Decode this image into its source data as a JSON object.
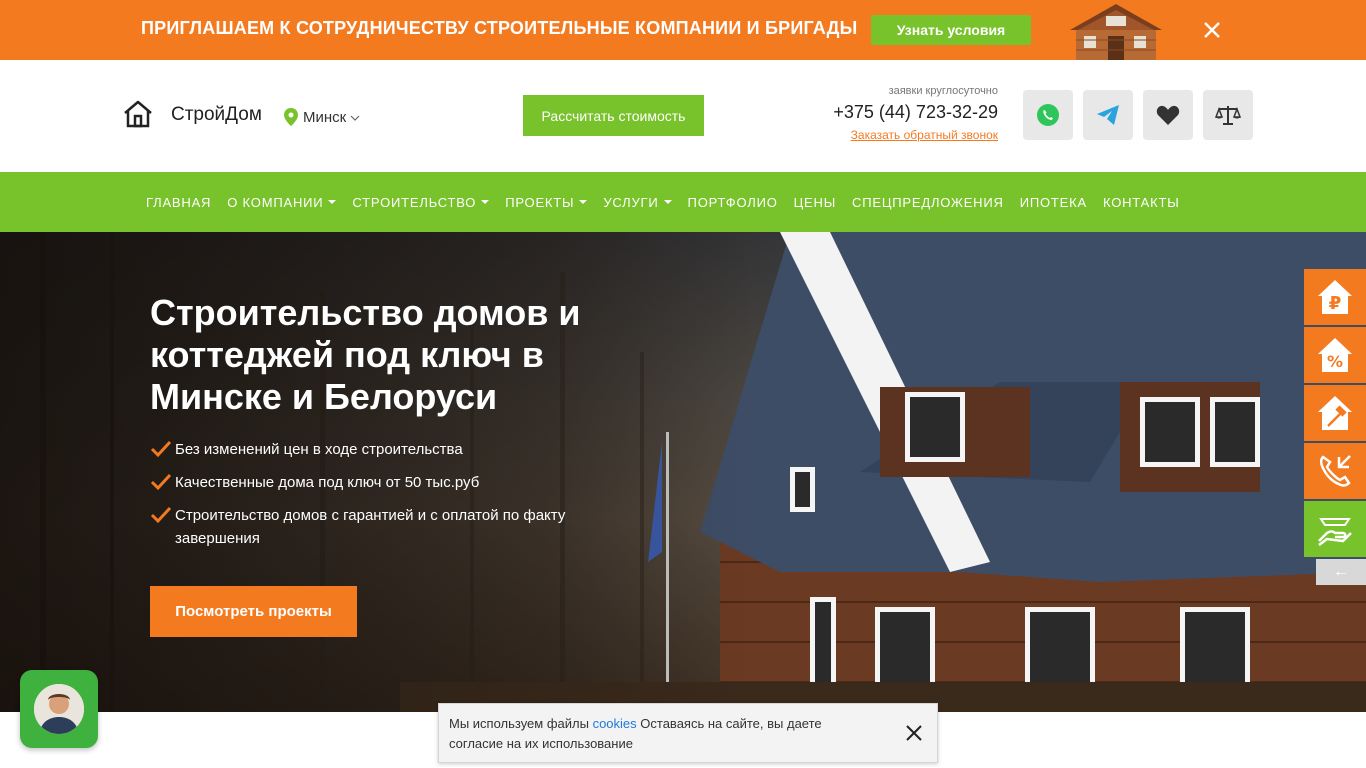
{
  "promo": {
    "text": "ПРИГЛАШАЕМ К СОТРУДНИЧЕСТВУ СТРОИТЕЛЬНЫЕ КОМПАНИИ И БРИГАДЫ",
    "button_label": "Узнать условия"
  },
  "header": {
    "logo_text": "СтройДом",
    "city": "Минск",
    "calc_button": "Рассчитать стоимость",
    "hours": "заявки круглосуточно",
    "phone": "+375 (44) 723-32-29",
    "callback": "Заказать обратный звонок",
    "icons": [
      "whatsapp-icon",
      "telegram-icon",
      "heart-icon",
      "scales-icon"
    ]
  },
  "nav": {
    "items": [
      {
        "label": "ГЛАВНАЯ"
      },
      {
        "label": "О КОМПАНИИ"
      },
      {
        "label": "СТРОИТЕЛЬСТВО"
      },
      {
        "label": "ПРОЕКТЫ"
      },
      {
        "label": "УСЛУГИ"
      },
      {
        "label": "ПОРТФОЛИО"
      },
      {
        "label": "ЦЕНЫ"
      },
      {
        "label": "СПЕЦПРЕДЛОЖЕНИЯ"
      },
      {
        "label": "ИПОТЕКА"
      },
      {
        "label": "КОНТАКТЫ"
      }
    ]
  },
  "hero": {
    "title": "Строительство домов и коттеджей под ключ в Минске и Белоруси",
    "bullets": [
      "Без изменений цен в ходе строительства",
      "Качественные дома под ключ от 50 тыс.руб",
      "Строительство домов с гарантией и с оплатой по факту завершения"
    ],
    "button": "Посмотреть проекты"
  },
  "side_widget": {
    "icons": [
      "ruble-house-icon",
      "percent-house-icon",
      "hammer-house-icon",
      "incoming-call-icon",
      "handshake-icon"
    ],
    "back": "←"
  },
  "cookie": {
    "text_before": "Мы используем файлы",
    "link": "cookies",
    "text_after": "Оставаясь на сайте, вы даете согласие на их использование"
  },
  "colors": {
    "accent_orange": "#f47a20",
    "accent_green": "#78c22b"
  }
}
